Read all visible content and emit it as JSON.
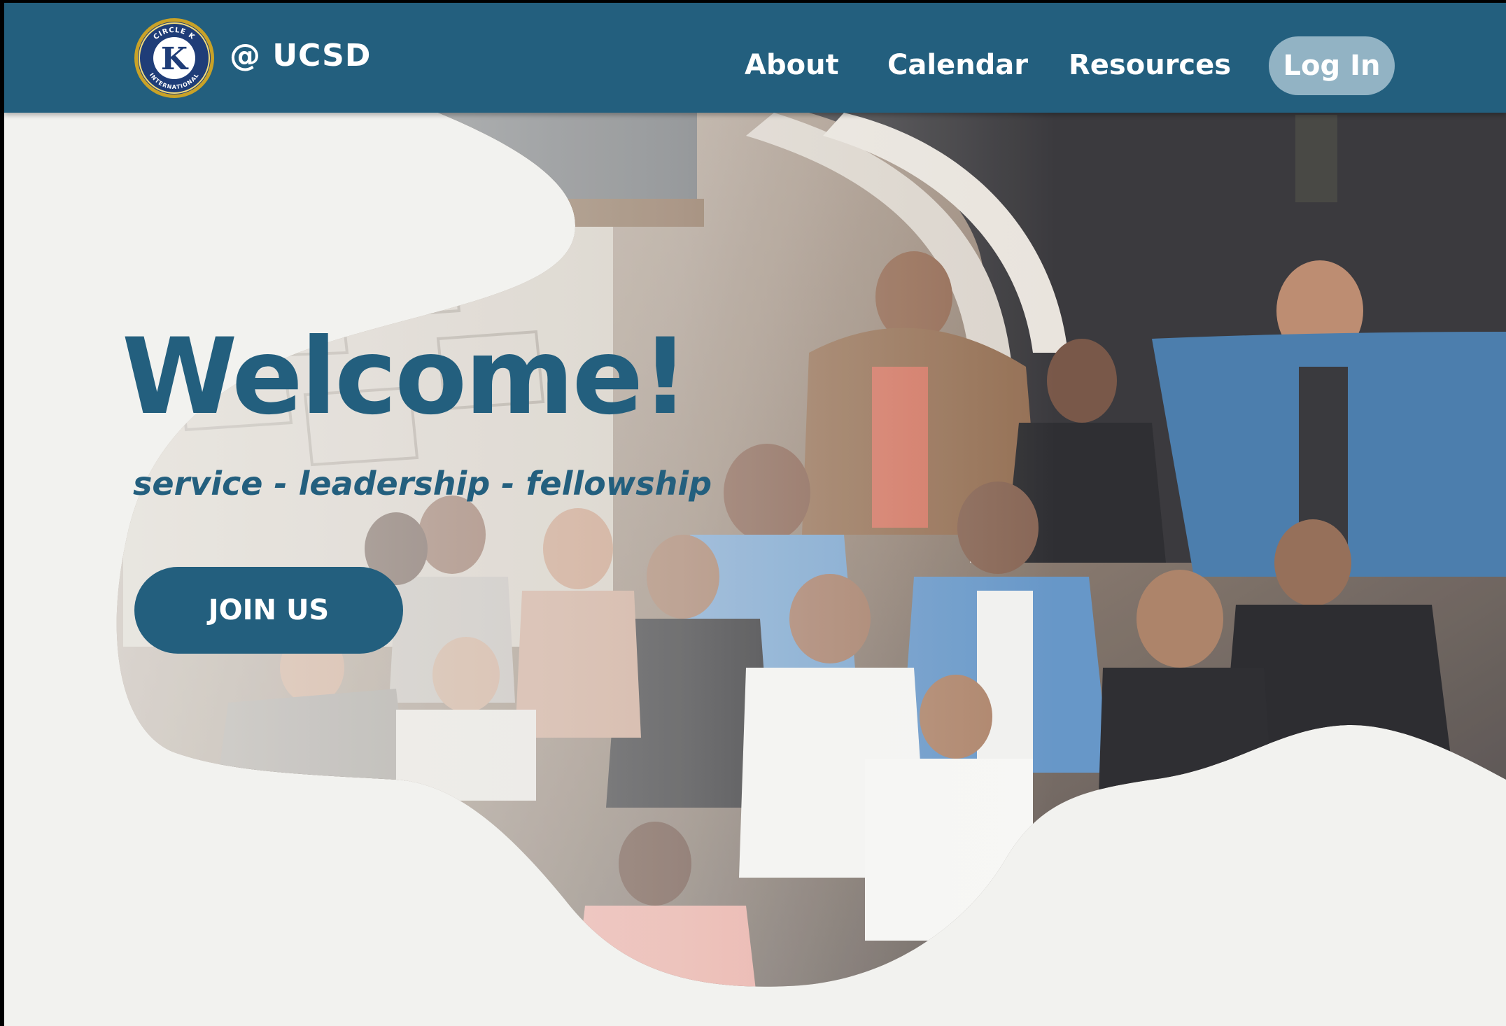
{
  "nav": {
    "brand": "@ UCSD",
    "logo_icon": "circle-k-international-logo",
    "logo_text_top": "CIRCLE K",
    "logo_text_bottom": "INTERNATIONAL",
    "logo_letter": "K",
    "links": [
      "About",
      "Calendar",
      "Resources"
    ],
    "login_label": "Log In"
  },
  "hero": {
    "title": "Welcome!",
    "tagline": "service - leadership - fellowship",
    "cta_label": "JOIN US",
    "photo": "group-photo-icon"
  },
  "colors": {
    "primary": "#235f7e",
    "login_bg": "#92b3c4",
    "page_bg": "#f2f2ef",
    "logo_gold": "#c9a227"
  }
}
